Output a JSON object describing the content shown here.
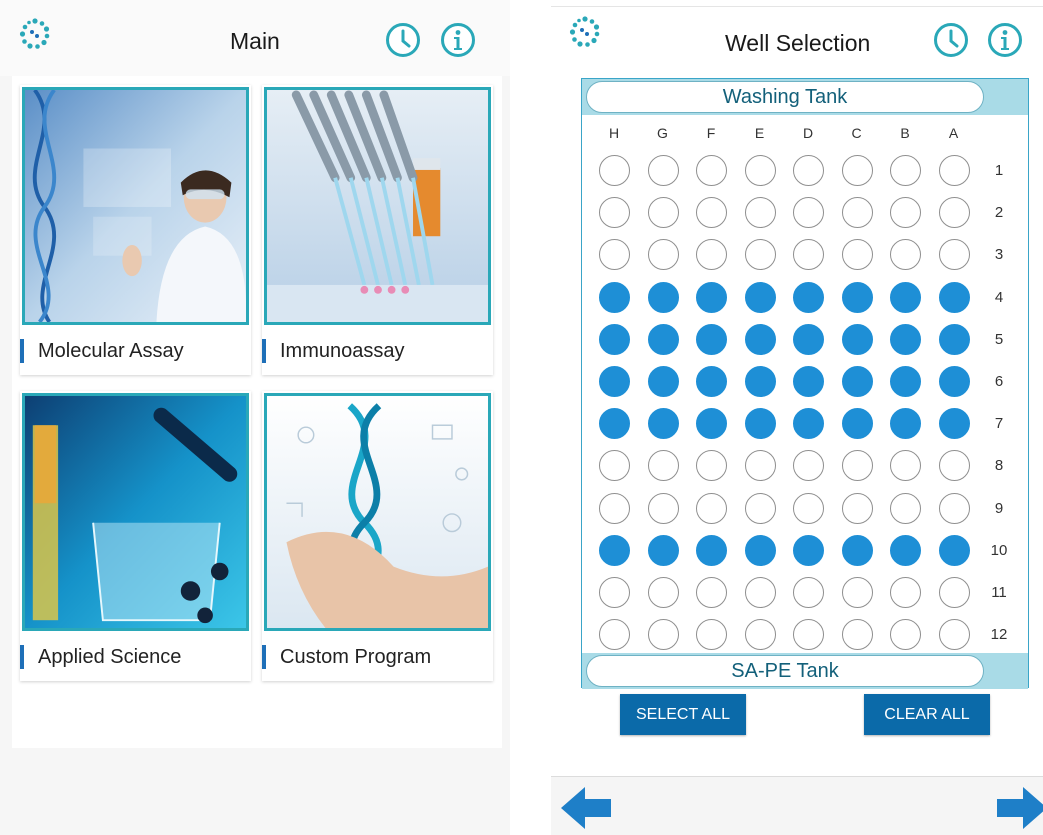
{
  "left_screen": {
    "title": "Main",
    "icons": {
      "logo": "app-logo-icon",
      "history": "clock-icon",
      "info": "info-icon"
    },
    "cards": [
      {
        "label": "Molecular Assay",
        "image": "scientist-dna-image"
      },
      {
        "label": "Immunoassay",
        "image": "pipette-image"
      },
      {
        "label": "Applied Science",
        "image": "lab-glassware-image"
      },
      {
        "label": "Custom Program",
        "image": "hand-dna-image"
      }
    ]
  },
  "right_screen": {
    "title": "Well Selection",
    "icons": {
      "logo": "app-logo-icon",
      "history": "clock-icon",
      "info": "info-icon",
      "back": "arrow-left-icon",
      "next": "arrow-right-icon"
    },
    "top_tank": "Washing Tank",
    "bottom_tank": "SA-PE Tank",
    "columns": [
      "H",
      "G",
      "F",
      "E",
      "D",
      "C",
      "B",
      "A"
    ],
    "rows": [
      "1",
      "2",
      "3",
      "4",
      "5",
      "6",
      "7",
      "8",
      "9",
      "10",
      "11",
      "12"
    ],
    "selected_rows": [
      "4",
      "5",
      "6",
      "7",
      "10"
    ],
    "select_all_label": "SELECT ALL",
    "clear_all_label": "CLEAR ALL"
  },
  "colors": {
    "accent_teal": "#2aa8b8",
    "selected_well": "#1e8fd6",
    "button_blue": "#0b6aa9",
    "tank_band": "#a9dbe7"
  }
}
